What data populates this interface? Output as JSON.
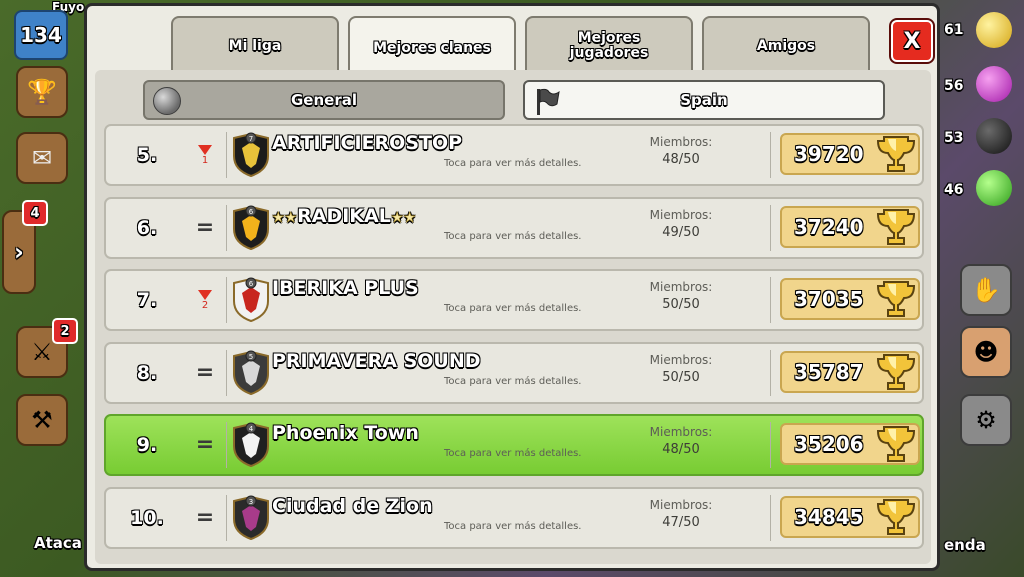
{
  "hud": {
    "player_name": "Fuyo",
    "level": "134",
    "war_badge": "4",
    "attack_badge": "2",
    "attack_label": "Ataca",
    "shop_label": "enda",
    "res_gold": "61",
    "res_elixir": "56",
    "res_dark": "53",
    "res_gems": "46"
  },
  "tabs": [
    {
      "label": "Mi liga",
      "active": false
    },
    {
      "label": "Mejores clanes",
      "active": true
    },
    {
      "label": "Mejores jugadores",
      "active": false
    },
    {
      "label": "Amigos",
      "active": false
    }
  ],
  "close_label": "X",
  "filters": {
    "general": "General",
    "country": "Spain"
  },
  "labels": {
    "members": "Miembros:",
    "tap_hint": "Toca para ver más detalles."
  },
  "colors": {
    "highlight_row": "#8fdb48",
    "trophy_box": "#f1d58c",
    "close_button": "#e52b1f"
  },
  "clans": [
    {
      "rank": "5.",
      "change": "down",
      "change_num": "1",
      "name": "ARTIFICIEROSTOP",
      "stars": false,
      "badge_level": "7",
      "badge_icon": "clan-badge-black-icon",
      "members": "48/50",
      "trophies": "39720",
      "highlight": false
    },
    {
      "rank": "6.",
      "change": "same",
      "change_num": "",
      "name": "RADIKAL",
      "stars": true,
      "badge_level": "6",
      "badge_icon": "clan-badge-fire-icon",
      "members": "49/50",
      "trophies": "37240",
      "highlight": false
    },
    {
      "rank": "7.",
      "change": "down",
      "change_num": "2",
      "name": "IBERIKA PLUS",
      "stars": false,
      "badge_level": "6",
      "badge_icon": "clan-badge-red-icon",
      "members": "50/50",
      "trophies": "37035",
      "highlight": false
    },
    {
      "rank": "8.",
      "change": "same",
      "change_num": "",
      "name": "PRIMAVERA SOUND",
      "stars": false,
      "badge_level": "5",
      "badge_icon": "clan-badge-grey-icon",
      "members": "50/50",
      "trophies": "35787",
      "highlight": false
    },
    {
      "rank": "9.",
      "change": "same",
      "change_num": "",
      "name": "Phoenix Town",
      "stars": false,
      "badge_level": "4",
      "badge_icon": "clan-badge-phoenix-icon",
      "members": "48/50",
      "trophies": "35206",
      "highlight": true
    },
    {
      "rank": "10.",
      "change": "same",
      "change_num": "",
      "name": "Ciudad de Zion",
      "stars": false,
      "badge_level": "3",
      "badge_icon": "clan-badge-dark-icon",
      "members": "47/50",
      "trophies": "34845",
      "highlight": false
    }
  ]
}
